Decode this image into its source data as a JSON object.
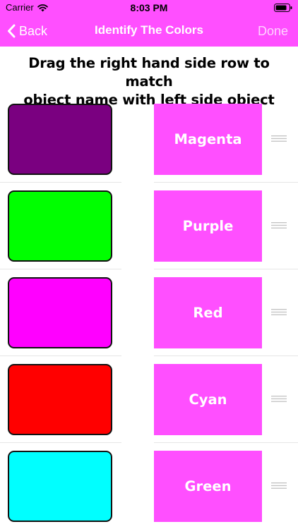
{
  "colors": {
    "accent": "#ff4fff",
    "swatches": [
      "#7a0080",
      "#00ff00",
      "#ff00ff",
      "#ff0000",
      "#00ffff"
    ]
  },
  "status_bar": {
    "carrier": "Carrier",
    "time": "8:03 PM",
    "wifi_icon": "wifi-icon",
    "battery_icon": "battery-icon"
  },
  "nav": {
    "back_label": "Back",
    "title": "Identify The Colors",
    "done_label": "Done"
  },
  "instruction": {
    "line1": "Drag the right hand side row to match",
    "line2": "object name with left side object"
  },
  "rows": [
    {
      "swatch_color": "#7a0080",
      "name": "Magenta"
    },
    {
      "swatch_color": "#00ff00",
      "name": "Purple"
    },
    {
      "swatch_color": "#ff00ff",
      "name": "Red"
    },
    {
      "swatch_color": "#ff0000",
      "name": "Cyan"
    },
    {
      "swatch_color": "#00ffff",
      "name": "Green"
    }
  ]
}
